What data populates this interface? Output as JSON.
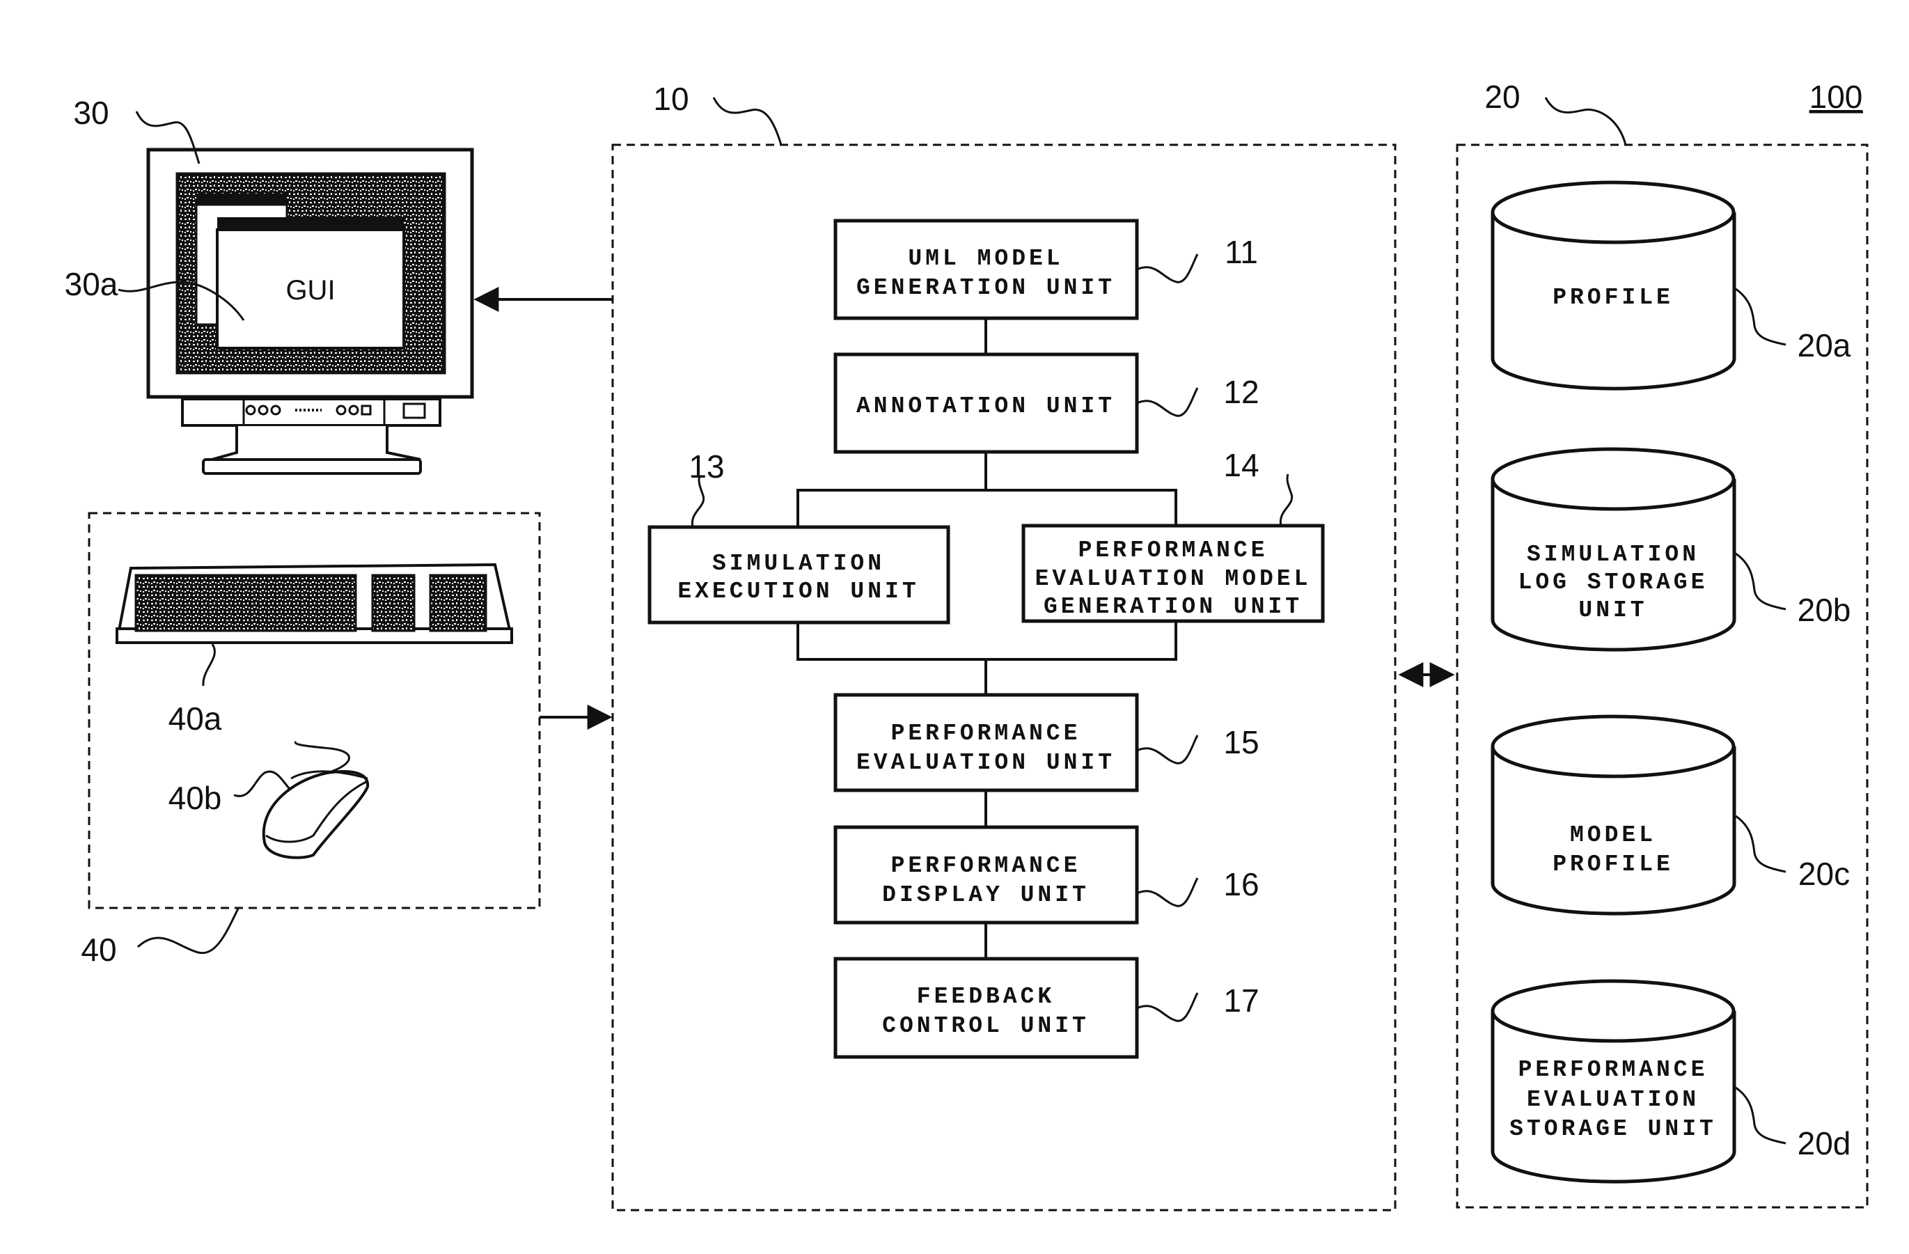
{
  "figure": {
    "system_ref": "100",
    "colors": {
      "ink": "#111111",
      "paper": "#ffffff"
    }
  },
  "monitor": {
    "ref": "30",
    "screen_ref": "30a",
    "screen_label": "GUI"
  },
  "input": {
    "ref": "40",
    "keyboard_ref": "40a",
    "mouse_ref": "40b"
  },
  "processor": {
    "ref": "10",
    "units": [
      {
        "ref": "11",
        "lines": [
          "UML MODEL",
          "GENERATION UNIT"
        ]
      },
      {
        "ref": "12",
        "lines": [
          "ANNOTATION UNIT"
        ]
      },
      {
        "ref": "13",
        "lines": [
          "SIMULATION",
          "EXECUTION UNIT"
        ]
      },
      {
        "ref": "14",
        "lines": [
          "PERFORMANCE",
          "EVALUATION MODEL",
          "GENERATION UNIT"
        ]
      },
      {
        "ref": "15",
        "lines": [
          "PERFORMANCE",
          "EVALUATION UNIT"
        ]
      },
      {
        "ref": "16",
        "lines": [
          "PERFORMANCE",
          "DISPLAY UNIT"
        ]
      },
      {
        "ref": "17",
        "lines": [
          "FEEDBACK",
          "CONTROL UNIT"
        ]
      }
    ]
  },
  "storage": {
    "ref": "20",
    "units": [
      {
        "ref": "20a",
        "lines": [
          "PROFILE"
        ]
      },
      {
        "ref": "20b",
        "lines": [
          "SIMULATION",
          "LOG STORAGE",
          "UNIT"
        ]
      },
      {
        "ref": "20c",
        "lines": [
          "MODEL",
          "PROFILE"
        ]
      },
      {
        "ref": "20d",
        "lines": [
          "PERFORMANCE",
          "EVALUATION",
          "STORAGE UNIT"
        ]
      }
    ]
  }
}
